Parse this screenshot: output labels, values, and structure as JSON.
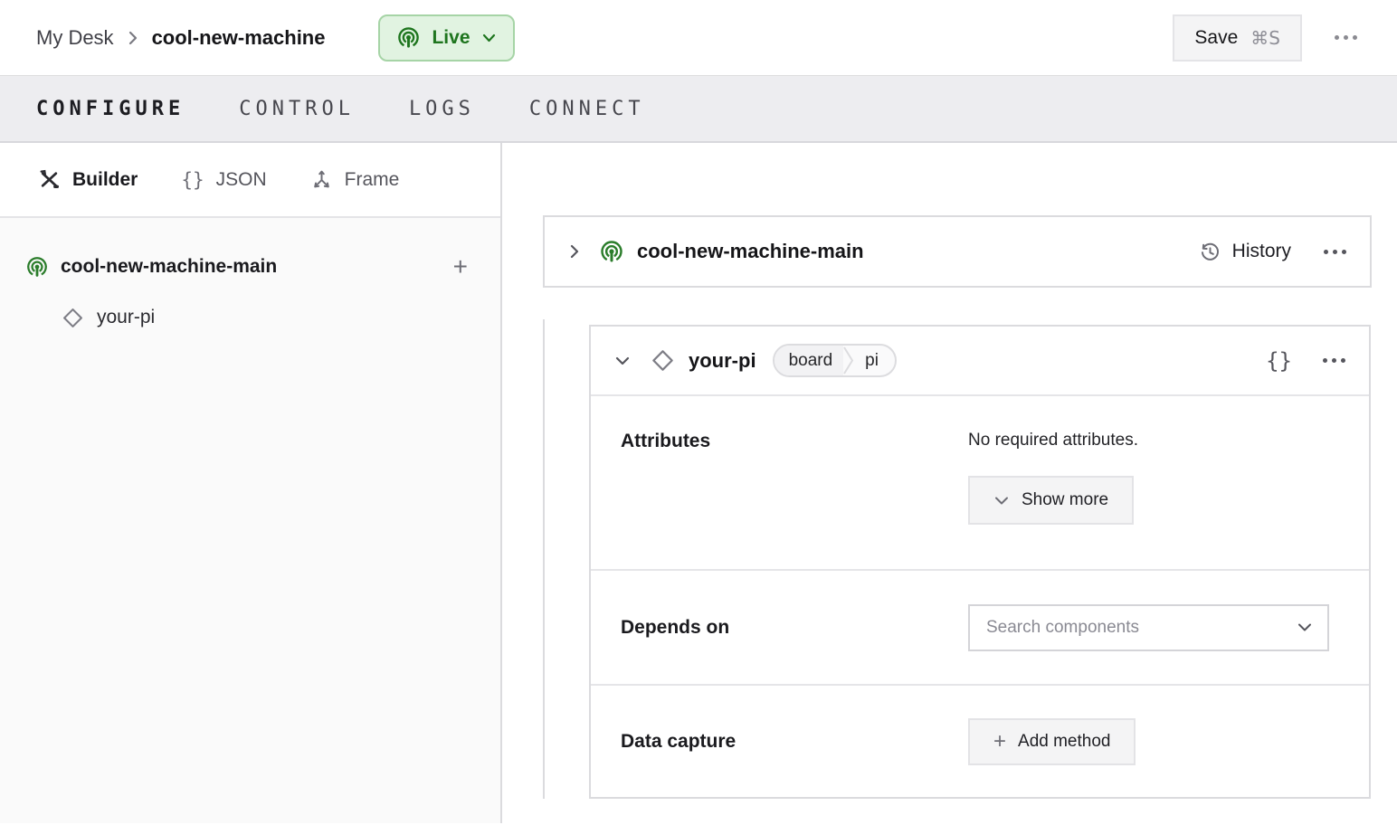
{
  "topbar": {
    "breadcrumb": {
      "parent": "My Desk",
      "current": "cool-new-machine"
    },
    "status": {
      "label": "Live",
      "state_color": "#1e751e",
      "bg_color": "#e1f3e1",
      "border_color": "#a6d4a6"
    },
    "save": {
      "label": "Save",
      "shortcut": "⌘S"
    }
  },
  "tabs": [
    {
      "label": "CONFIGURE",
      "active": true
    },
    {
      "label": "CONTROL",
      "active": false
    },
    {
      "label": "LOGS",
      "active": false
    },
    {
      "label": "CONNECT",
      "active": false
    }
  ],
  "sidebar": {
    "views": [
      {
        "label": "Builder",
        "icon": "tools-icon",
        "active": true
      },
      {
        "label": "JSON",
        "icon": "braces-icon",
        "active": false
      },
      {
        "label": "Frame",
        "icon": "frame-axes-icon",
        "active": false
      }
    ],
    "tree": [
      {
        "label": "cool-new-machine-main",
        "icon": "machine-live-icon",
        "add_action": "+"
      },
      {
        "label": "your-pi",
        "icon": "component-diamond-icon"
      }
    ]
  },
  "main": {
    "machine_card": {
      "title": "cool-new-machine-main",
      "history_label": "History",
      "icon": "machine-live-icon"
    },
    "component_card": {
      "title": "your-pi",
      "icon": "component-diamond-icon",
      "tags": [
        {
          "label": "board"
        },
        {
          "label": "pi"
        }
      ],
      "sections": {
        "attributes": {
          "label": "Attributes",
          "empty_text": "No required attributes.",
          "show_more_label": "Show more"
        },
        "depends_on": {
          "label": "Depends on",
          "placeholder": "Search components"
        },
        "data_capture": {
          "label": "Data capture",
          "add_method_label": "Add method"
        }
      }
    }
  },
  "icons": {
    "braces_glyph": "{}",
    "plus_glyph": "+"
  },
  "colors": {
    "accent_green": "#2b7d2b",
    "border_light": "#dbdbde",
    "tabbar_bg": "#ededf0",
    "button_bg": "#f4f4f5",
    "sidebar_bg": "#fafafa"
  }
}
